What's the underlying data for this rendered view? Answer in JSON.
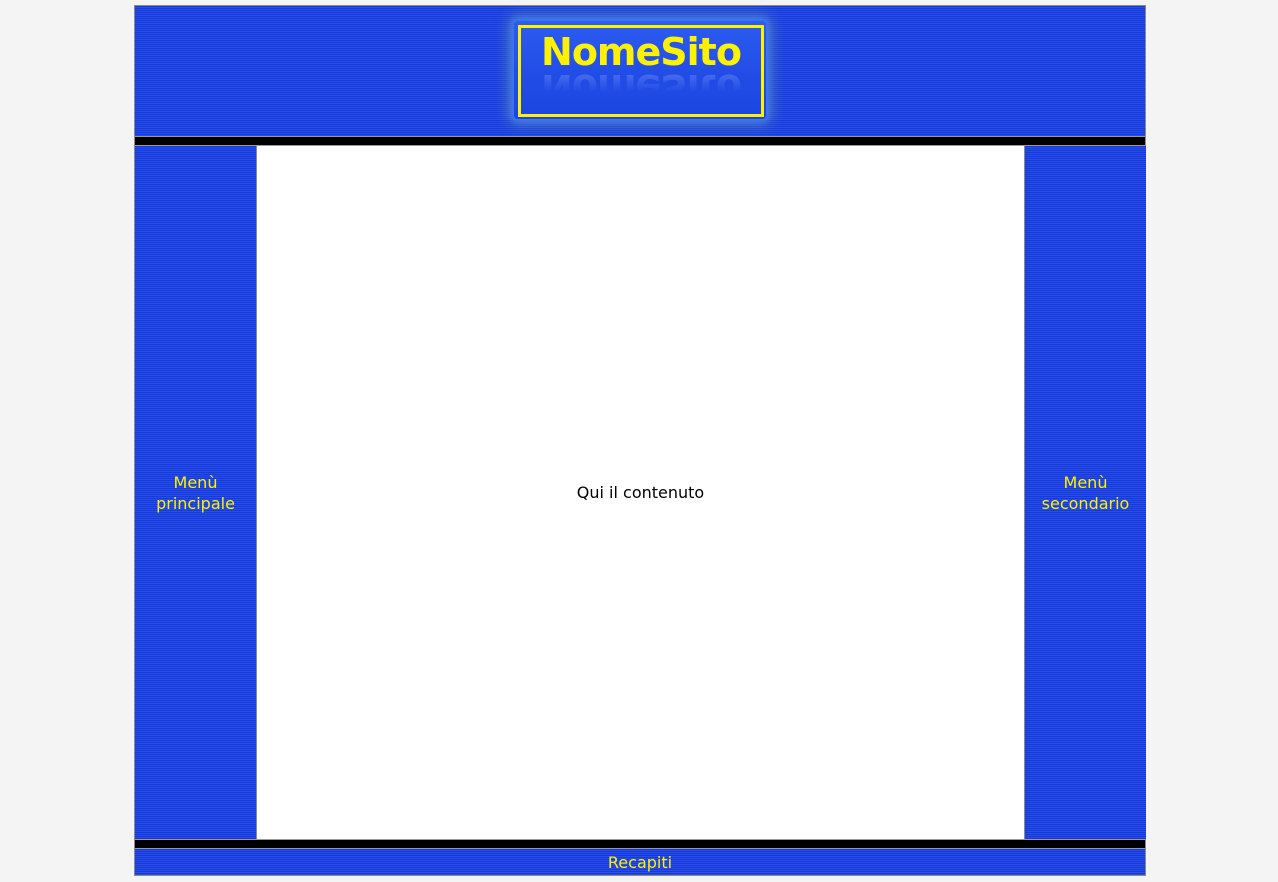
{
  "header": {
    "logo_text": "NomeSito"
  },
  "left_menu": {
    "line1": "Menù",
    "line2": "principale"
  },
  "right_menu": {
    "line1": "Menù",
    "line2": "secondario"
  },
  "main": {
    "content_text": "Qui il contenuto"
  },
  "footer": {
    "label": "Recapiti"
  },
  "colors": {
    "page_background": "#f4f4f4",
    "panel_blue": "#1a3fe6",
    "accent_yellow": "#fff200",
    "divider_black": "#000000",
    "content_background": "#ffffff"
  }
}
